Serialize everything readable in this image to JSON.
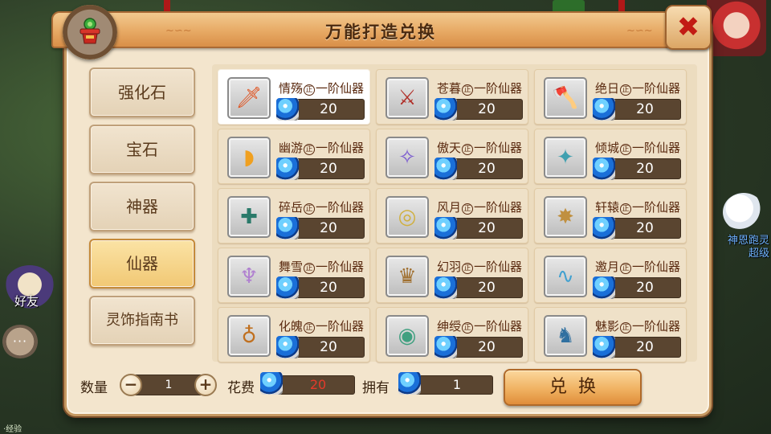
{
  "title": "万能打造兑换",
  "hud": {
    "friend_label": "好友",
    "chat_icon_text": "···",
    "right_text_line1": "神恩跑灵",
    "right_text_line2": "超级",
    "bottom_text": "·经验"
  },
  "sidebar": {
    "items": [
      {
        "label": "强化石",
        "active": false
      },
      {
        "label": "宝石",
        "active": false
      },
      {
        "label": "神器",
        "active": false
      },
      {
        "label": "仙器",
        "active": true
      },
      {
        "label": "灵饰指南书",
        "active": false
      }
    ]
  },
  "grid": {
    "zheng_mark": "正",
    "items": [
      {
        "name": "情殇",
        "tier": "一阶仙器",
        "cost": "20",
        "icon": "sword-icon",
        "selected": true
      },
      {
        "name": "苍暮",
        "tier": "一阶仙器",
        "cost": "20",
        "icon": "spear-icon",
        "selected": false
      },
      {
        "name": "绝日",
        "tier": "一阶仙器",
        "cost": "20",
        "icon": "axe-icon",
        "selected": false
      },
      {
        "name": "幽游",
        "tier": "一阶仙器",
        "cost": "20",
        "icon": "fan-icon",
        "selected": false
      },
      {
        "name": "傲天",
        "tier": "一阶仙器",
        "cost": "20",
        "icon": "staff-icon",
        "selected": false
      },
      {
        "name": "倾城",
        "tier": "一阶仙器",
        "cost": "20",
        "icon": "blade-icon",
        "selected": false
      },
      {
        "name": "碎岳",
        "tier": "一阶仙器",
        "cost": "20",
        "icon": "hammer-icon",
        "selected": false
      },
      {
        "name": "风月",
        "tier": "一阶仙器",
        "cost": "20",
        "icon": "ring-icon",
        "selected": false
      },
      {
        "name": "轩辕",
        "tier": "一阶仙器",
        "cost": "20",
        "icon": "star-weapon-icon",
        "selected": false
      },
      {
        "name": "舞雪",
        "tier": "一阶仙器",
        "cost": "20",
        "icon": "skirt-icon",
        "selected": false
      },
      {
        "name": "幻羽",
        "tier": "一阶仙器",
        "cost": "20",
        "icon": "crown-icon",
        "selected": false
      },
      {
        "name": "邀月",
        "tier": "一阶仙器",
        "cost": "20",
        "icon": "ribbon-icon",
        "selected": false
      },
      {
        "name": "化魄",
        "tier": "一阶仙器",
        "cost": "20",
        "icon": "pendant-icon",
        "selected": false
      },
      {
        "name": "绅绶",
        "tier": "一阶仙器",
        "cost": "20",
        "icon": "bracelet-icon",
        "selected": false
      },
      {
        "name": "魅影",
        "tier": "一阶仙器",
        "cost": "20",
        "icon": "boots-icon",
        "selected": false
      }
    ]
  },
  "footer": {
    "quantity_label": "数量",
    "quantity_value": "1",
    "minus": "−",
    "plus": "+",
    "cost_label": "花费",
    "cost_value": "20",
    "owned_label": "拥有",
    "owned_value": "1",
    "exchange_label": "兑换"
  },
  "close_label": "✖",
  "colors": {
    "panel": "#f3e5cd",
    "title_bar": "#e7a964",
    "active_tab": "#f1c874",
    "cost_red": "#e43a2a"
  }
}
